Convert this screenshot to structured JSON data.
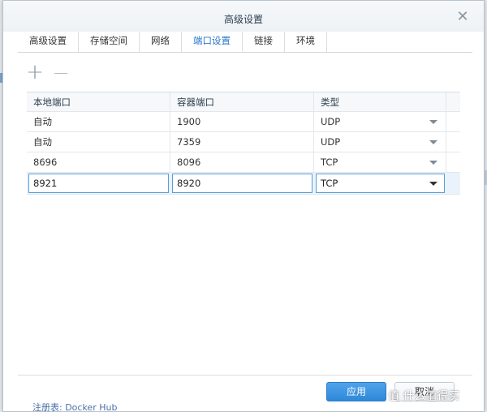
{
  "dialog": {
    "title": "高级设置",
    "close_glyph": "✕"
  },
  "tabs": [
    {
      "label": "高级设置",
      "active": false
    },
    {
      "label": "存储空间",
      "active": false
    },
    {
      "label": "网络",
      "active": false
    },
    {
      "label": "端口设置",
      "active": true
    },
    {
      "label": "链接",
      "active": false
    },
    {
      "label": "环境",
      "active": false
    }
  ],
  "toolbar": {
    "add_glyph": "+",
    "remove_glyph": "—"
  },
  "table": {
    "columns": [
      "本地端口",
      "容器端口",
      "类型"
    ],
    "rows": [
      {
        "local": "自动",
        "container": "1900",
        "type": "UDP"
      },
      {
        "local": "自动",
        "container": "7359",
        "type": "UDP"
      },
      {
        "local": "8696",
        "container": "8096",
        "type": "TCP"
      }
    ],
    "editing_row": {
      "local": "8921",
      "container": "8920",
      "type": "TCP"
    }
  },
  "buttons": {
    "apply": "应用",
    "cancel": "取消"
  },
  "background": {
    "bottom_text": "注册表: Docker Hub"
  },
  "watermark": "值 什么值得买",
  "colors": {
    "accent": "#2a77c9",
    "apply_button": "#3a93df"
  }
}
